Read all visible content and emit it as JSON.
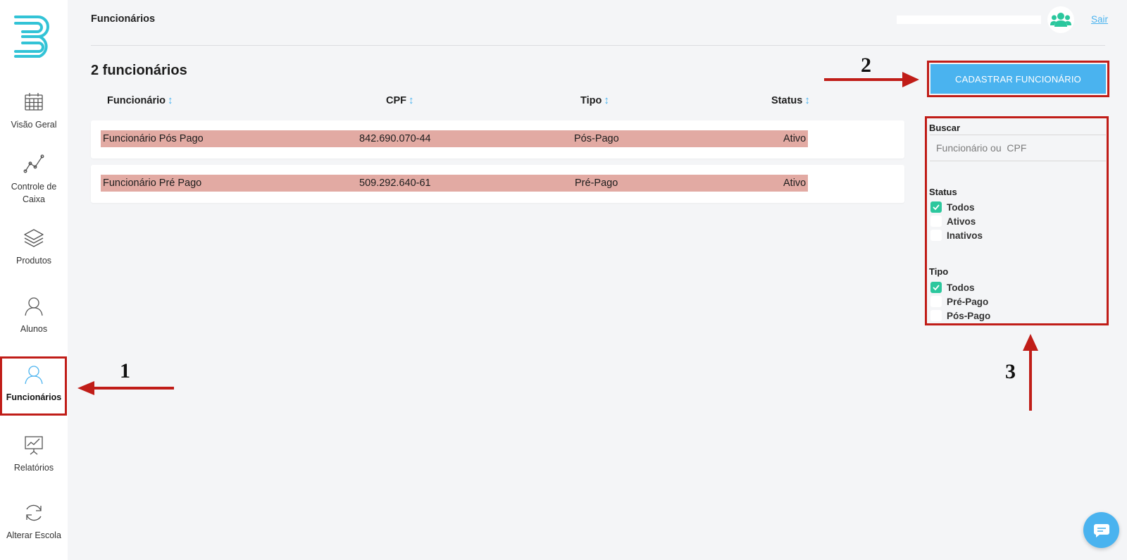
{
  "sidebar": {
    "items": [
      {
        "label": "Visão Geral",
        "icon": "calendar-icon"
      },
      {
        "label": "Controle de Caixa",
        "icon": "line-chart-icon"
      },
      {
        "label": "Produtos",
        "icon": "layers-icon"
      },
      {
        "label": "Alunos",
        "icon": "user-icon"
      },
      {
        "label": "Funcionários",
        "icon": "user-icon"
      },
      {
        "label": "Relatórios",
        "icon": "presentation-chart-icon"
      },
      {
        "label": "Alterar Escola",
        "icon": "refresh-icon"
      }
    ],
    "active_index": 4
  },
  "header": {
    "title": "Funcionários",
    "logout_label": "Sair"
  },
  "main": {
    "count_label": "2 funcionários",
    "columns": [
      "Funcionário",
      "CPF",
      "Tipo",
      "Status"
    ],
    "rows": [
      {
        "name": "Funcionário Pós Pago",
        "cpf": "842.690.070-44",
        "tipo": "Pós-Pago",
        "status": "Ativo"
      },
      {
        "name": "Funcionário Pré Pago",
        "cpf": "509.292.640-61",
        "tipo": "Pré-Pago",
        "status": "Ativo"
      }
    ]
  },
  "actions": {
    "register_label": "CADASTRAR FUNCIONÁRIO"
  },
  "filters": {
    "search_label": "Buscar",
    "search_placeholder": "Funcionário ou  CPF",
    "status_label": "Status",
    "status_options": [
      {
        "label": "Todos",
        "checked": true
      },
      {
        "label": "Ativos",
        "checked": false
      },
      {
        "label": "Inativos",
        "checked": false
      }
    ],
    "tipo_label": "Tipo",
    "tipo_options": [
      {
        "label": "Todos",
        "checked": true
      },
      {
        "label": "Pré-Pago",
        "checked": false
      },
      {
        "label": "Pós-Pago",
        "checked": false
      }
    ]
  },
  "annotations": {
    "one": "1",
    "two": "2",
    "three": "3"
  },
  "colors": {
    "accent": "#4ab3ef",
    "checkbox_on": "#2bc79d",
    "row_highlight": "#e2aaa3",
    "annotation_red": "#c01d18"
  }
}
